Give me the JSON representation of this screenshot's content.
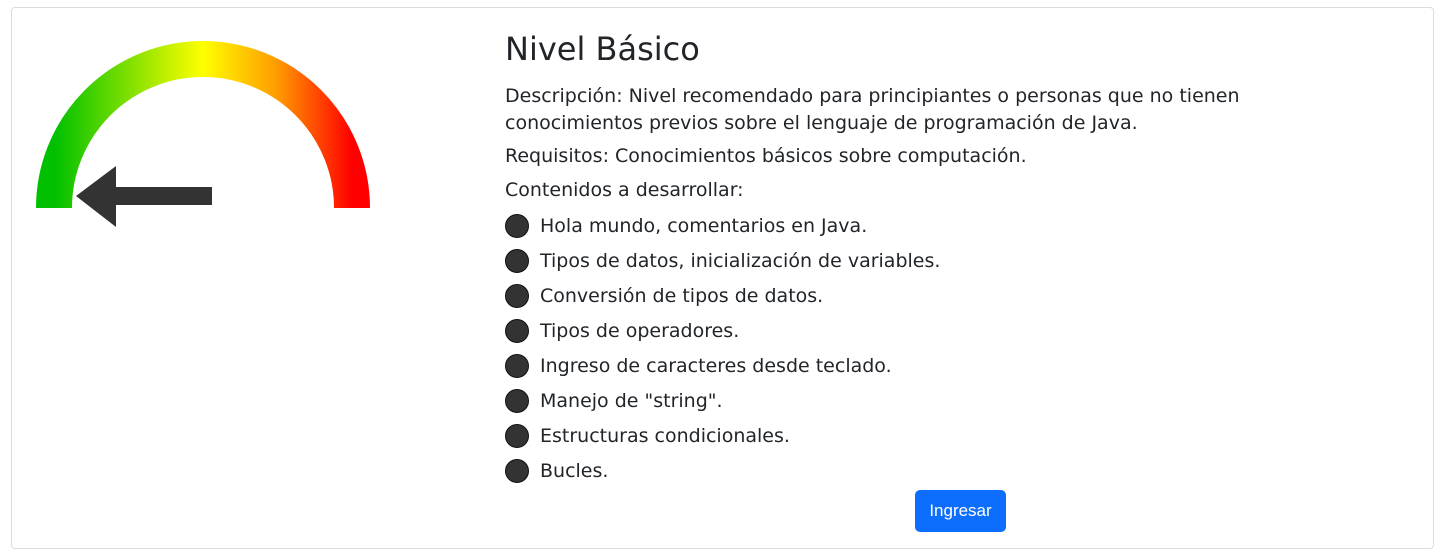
{
  "level": {
    "title": "Nivel Básico",
    "description": "Descripción: Nivel recomendado para principiantes o personas que no tienen conocimientos previos sobre el lenguaje de programación de Java.",
    "requirements": "Requisitos: Conocimientos básicos sobre computación.",
    "contents_heading": "Contenidos a desarrollar:",
    "topics": [
      "Hola mundo, comentarios en Java.",
      "Tipos de datos, inicialización de variables.",
      "Conversión de tipos de datos.",
      "Tipos de operadores.",
      "Ingreso de caracteres desde teclado.",
      "Manejo de \"string\".",
      "Estructuras condicionales.",
      "Bucles."
    ],
    "button_label": "Ingresar"
  },
  "gauge": {
    "icon": "difficulty-gauge-icon",
    "pointer_icon": "arrow-left-icon",
    "level_fraction": 0,
    "colors": {
      "low": "#00c000",
      "mid": "#ffff00",
      "high": "#ff0000",
      "pointer": "#333333"
    }
  },
  "colors": {
    "button": "#0d6efd",
    "text": "#212529",
    "bullet": "#333333"
  }
}
